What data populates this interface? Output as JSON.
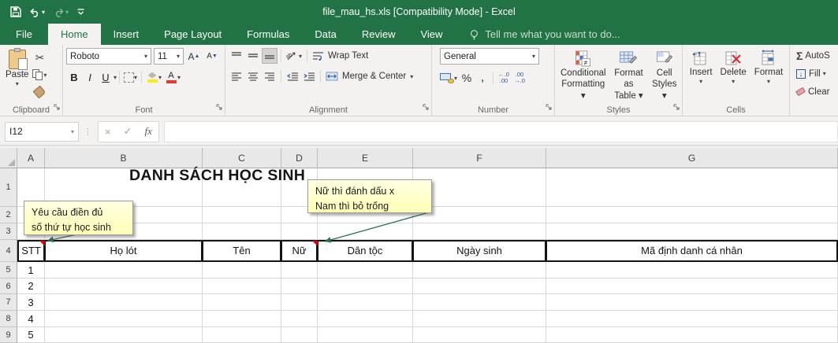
{
  "titlebar": {
    "title": "file_mau_hs.xls  [Compatibility Mode] - Excel"
  },
  "tabs": {
    "items": [
      "File",
      "Home",
      "Insert",
      "Page Layout",
      "Formulas",
      "Data",
      "Review",
      "View"
    ],
    "active": "Home",
    "tell_me": "Tell me what you want to do..."
  },
  "ribbon": {
    "clipboard": {
      "label": "Clipboard",
      "paste": "Paste"
    },
    "font": {
      "label": "Font",
      "name": "Roboto",
      "size": "11",
      "bold": "B",
      "italic": "I",
      "underline": "U",
      "grow": "A",
      "shrink": "A"
    },
    "alignment": {
      "label": "Alignment",
      "wrap": "Wrap Text",
      "merge": "Merge & Center"
    },
    "number": {
      "label": "Number",
      "format": "General",
      "percent": "%",
      "comma": ",",
      "inc_decimal": "←.0\n.00",
      "dec_decimal": ".00\n→.0"
    },
    "styles": {
      "label": "Styles",
      "conditional": "Conditional\nFormatting ▾",
      "format_table": "Format as\nTable ▾",
      "cell_styles": "Cell\nStyles ▾"
    },
    "cells": {
      "label": "Cells",
      "insert": "Insert",
      "delete": "Delete",
      "format": "Format"
    },
    "editing": {
      "autosum_symbol": "Σ",
      "autosum": "AutoS",
      "fill": "Fill",
      "clear": "Clear"
    }
  },
  "formula_bar": {
    "name_box": "I12",
    "cancel": "×",
    "enter": "✓",
    "fx": "fx",
    "formula": ""
  },
  "sheet": {
    "col_headers": [
      "A",
      "B",
      "C",
      "D",
      "E",
      "F",
      "G"
    ],
    "row_headers": [
      "1",
      "2",
      "3",
      "4",
      "5",
      "6",
      "7",
      "8",
      "9"
    ],
    "title": "DANH SÁCH HỌC SINH",
    "table_header": [
      "STT",
      "Họ lót",
      "Tên",
      "Nữ",
      "Dân tộc",
      "Ngày sinh",
      "Mã định danh cá nhân"
    ],
    "stt_values": [
      "1",
      "2",
      "3",
      "4",
      "5"
    ],
    "comments": {
      "a4": "Yêu cầu điền đủ\nsố thứ tự học sinh",
      "d4": "Nữ thì đánh dấu x\nNam thì bỏ trống"
    }
  },
  "colors": {
    "excel_green": "#217346",
    "comment_bg": "#ffffc9",
    "table_border": "#141414",
    "comment_indicator": "#e00000"
  }
}
